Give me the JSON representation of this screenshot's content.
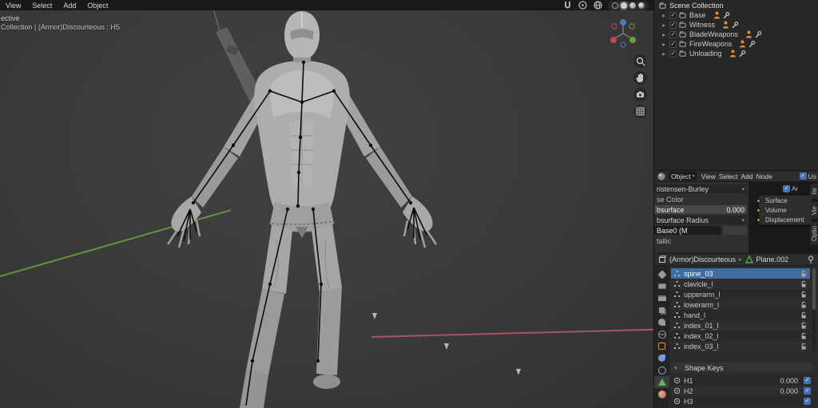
{
  "viewport": {
    "menus": [
      {
        "label": "View"
      },
      {
        "label": "Select"
      },
      {
        "label": "Add"
      },
      {
        "label": "Object"
      }
    ],
    "overlay": {
      "line1": "ective",
      "line2": "Collection | (Armor)Discourteous : H5"
    }
  },
  "outliner": {
    "root_label": "Scene Collection",
    "items": [
      {
        "name": "Base"
      },
      {
        "name": "Witness"
      },
      {
        "name": "BladeWeapons"
      },
      {
        "name": "FireWeapons"
      },
      {
        "name": "Unloading"
      }
    ]
  },
  "shader_editor": {
    "mode_label": "Object",
    "menus": [
      {
        "label": "View"
      },
      {
        "label": "Select"
      },
      {
        "label": "Add"
      },
      {
        "label": "Node"
      }
    ],
    "use_nodes_label": "Us",
    "props": {
      "falloff_dropdown": "ristensen-Burley",
      "base_color_label": "se Color",
      "subsurface_label": "bsurface",
      "subsurface_value": "0.000",
      "radius_label": "bsurface Radius",
      "name_input": "Base0 (M",
      "metallic_label": "tallic"
    },
    "node": {
      "fields": [
        {
          "label": "Surface"
        },
        {
          "label": "Volume"
        },
        {
          "label": "Displacement"
        }
      ],
      "overlay_label": "Ar"
    },
    "side_tabs": [
      {
        "label": "Ite"
      },
      {
        "label": "Vie"
      },
      {
        "label": "Optio"
      }
    ]
  },
  "properties": {
    "breadcrumb": {
      "object": "(Armor)Discourteous",
      "data": "Plane.002"
    },
    "tabs": [
      {
        "icon": "tool"
      },
      {
        "icon": "render"
      },
      {
        "icon": "output"
      },
      {
        "icon": "view-layer"
      },
      {
        "icon": "scene"
      },
      {
        "icon": "world"
      },
      {
        "icon": "object"
      },
      {
        "icon": "modifiers"
      },
      {
        "icon": "physics"
      },
      {
        "icon": "object-data",
        "active": true
      },
      {
        "icon": "material"
      }
    ],
    "vertex_groups": [
      {
        "name": "spine_03",
        "selected": true
      },
      {
        "name": "clavicle_l"
      },
      {
        "name": "upperarm_l"
      },
      {
        "name": "lowerarm_l"
      },
      {
        "name": "hand_l"
      },
      {
        "name": "index_01_l"
      },
      {
        "name": "index_02_l"
      },
      {
        "name": "index_03_l"
      }
    ],
    "shape_keys_label": "Shape Keys",
    "shape_keys": [
      {
        "name": "H1",
        "value": "0.000"
      },
      {
        "name": "H2",
        "value": "0.000"
      },
      {
        "name": "H3",
        "value": ""
      }
    ]
  },
  "colors": {
    "accent_blue": "#4772b3",
    "selected_row": "#3f6d9f",
    "axis_green": "#69a340",
    "axis_red": "#b5556b",
    "icon_orange": "#d98d3c"
  }
}
